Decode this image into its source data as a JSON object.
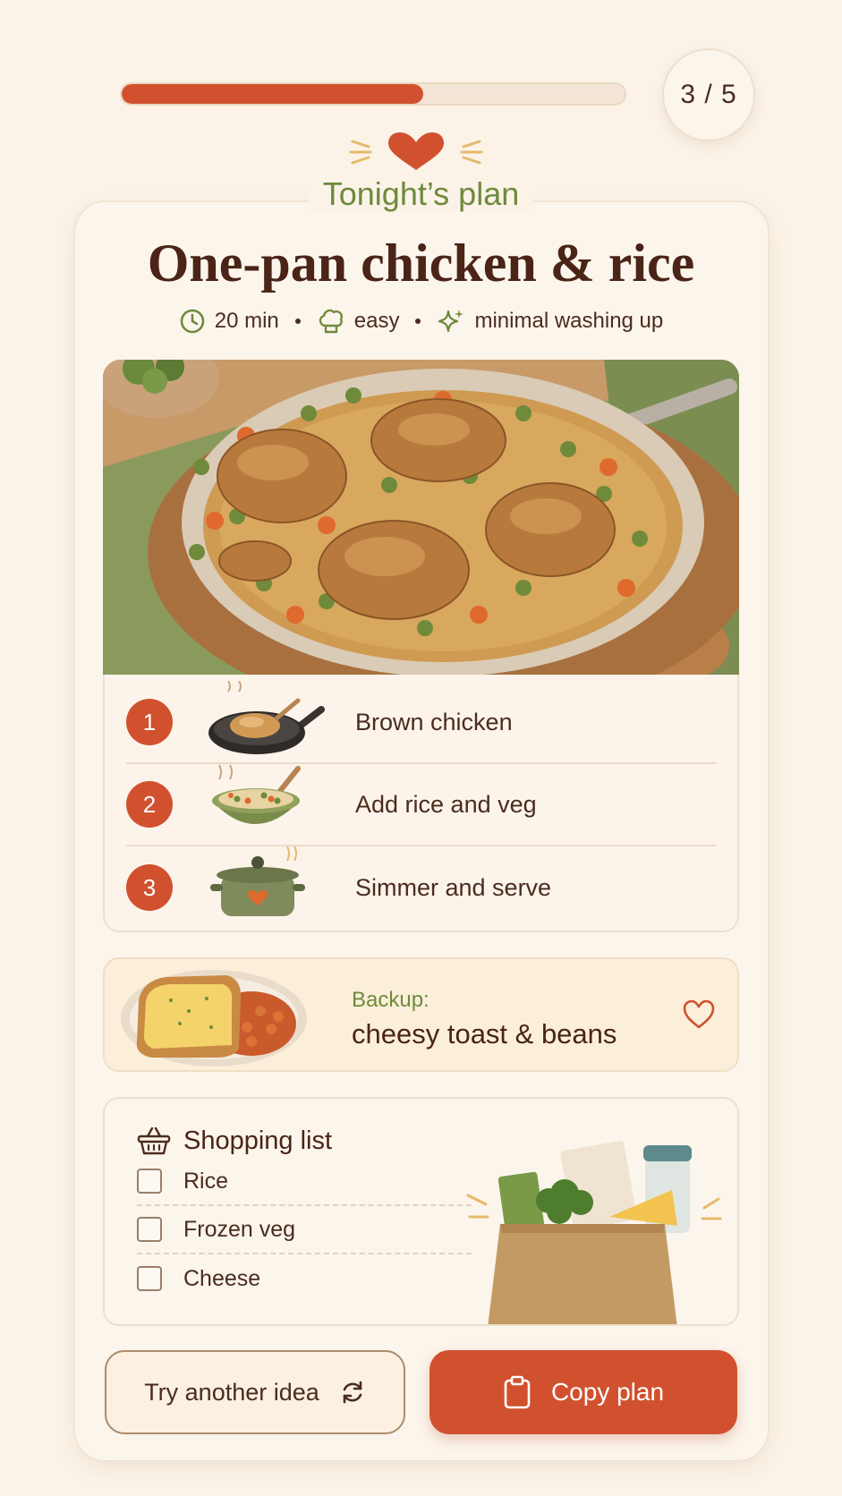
{
  "progress": {
    "step_text": "3 / 5",
    "fraction": 0.6
  },
  "eyebrow": "Tonight’s plan",
  "recipe": {
    "title": "One-pan chicken & rice",
    "time": "20 min",
    "difficulty": "easy",
    "cleanup": "minimal washing up"
  },
  "steps": [
    {
      "number": "1",
      "label": "Brown chicken"
    },
    {
      "number": "2",
      "label": "Add rice and veg"
    },
    {
      "number": "3",
      "label": "Simmer and serve"
    }
  ],
  "backup": {
    "kicker": "Backup:",
    "dish": "cheesy toast & beans"
  },
  "shopping": {
    "title": "Shopping list",
    "items": [
      "Rice",
      "Frozen veg",
      "Cheese"
    ]
  },
  "actions": {
    "secondary": "Try another idea",
    "primary": "Copy plan"
  },
  "colors": {
    "accent": "#d1512f",
    "green": "#6e8a3c",
    "background": "#fbf3e8",
    "text": "#4a2417"
  }
}
